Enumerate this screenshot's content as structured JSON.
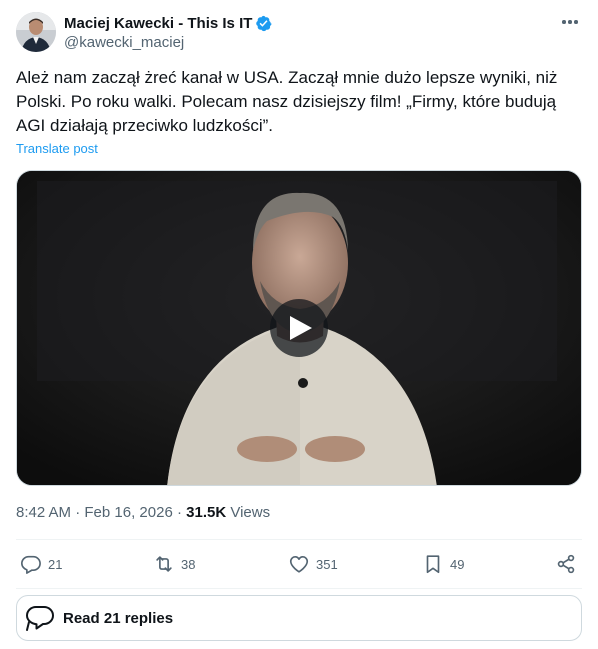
{
  "author": {
    "display_name": "Maciej Kawecki - This Is IT",
    "handle": "@kawecki_maciej",
    "verified": true
  },
  "post": {
    "text": "Ależ nam zaczął żreć kanał w USA. Zaczął mnie dużo lepsze wyniki, niż Polski. Po roku walki. Polecam nasz dzisiejszy film! „Firmy, które budują AGI działają przeciwko ludzkości”.",
    "translate_label": "Translate post"
  },
  "meta": {
    "time": "8:42 AM",
    "date": "Feb 16, 2026",
    "views_count": "31.5K",
    "views_label": "Views",
    "separator": "·"
  },
  "actions": {
    "replies": "21",
    "reposts": "38",
    "likes": "351",
    "bookmarks": "49"
  },
  "read_replies_label": "Read 21 replies",
  "icons": [
    "more-icon",
    "verified-badge-icon",
    "play-icon",
    "reply-icon",
    "repost-icon",
    "like-icon",
    "bookmark-icon",
    "share-icon",
    "replies-bubble-icon"
  ],
  "colors": {
    "accent": "#1d9bf0",
    "secondary_text": "#536471",
    "primary_text": "#0f1419",
    "border": "#cfd9de"
  }
}
